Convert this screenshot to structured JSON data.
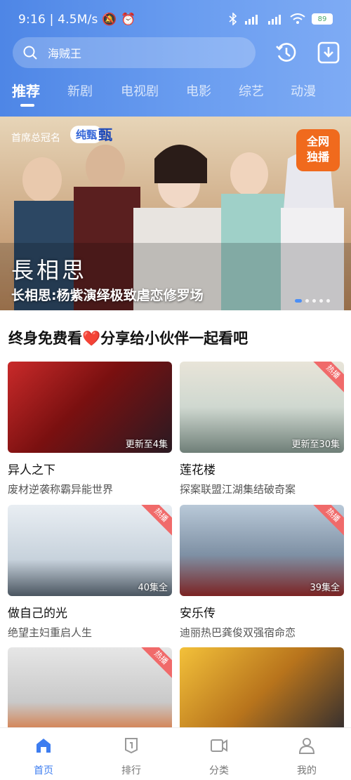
{
  "status": {
    "time": "9:16",
    "speed": "4.5M/s",
    "battery": "89"
  },
  "search": {
    "value": "海贼王"
  },
  "tabs": [
    {
      "label": "推荐",
      "active": true
    },
    {
      "label": "新剧"
    },
    {
      "label": "电视剧"
    },
    {
      "label": "电影"
    },
    {
      "label": "综艺"
    },
    {
      "label": "动漫"
    }
  ],
  "banner": {
    "sponsor": "首席总冠名",
    "sponsor_logo_1": "纯甄",
    "sponsor_logo_2": "甄",
    "badge_line1": "全网",
    "badge_line2": "独播",
    "drama_title": "長相思",
    "caption": "长相思:杨紫演绎极致虐恋修罗场"
  },
  "section": {
    "title": "终身免费看❤️分享给小伙伴一起看吧"
  },
  "cards": [
    {
      "title": "异人之下",
      "desc": "废材逆袭称霸异能世界",
      "episodes": "更新至4集",
      "corner": ""
    },
    {
      "title": "莲花楼",
      "desc": "探案联盟江湖集结破奇案",
      "episodes": "更新至30集",
      "corner": "热播"
    },
    {
      "title": "做自己的光",
      "desc": "绝望主妇重启人生",
      "episodes": "40集全",
      "corner": "热播"
    },
    {
      "title": "安乐传",
      "desc": "迪丽热巴龚俊双强宿命恋",
      "episodes": "39集全",
      "corner": "热播"
    },
    {
      "title": "",
      "desc": "",
      "episodes": "",
      "corner": "热播"
    },
    {
      "title": "",
      "desc": "",
      "episodes": "",
      "corner": ""
    }
  ],
  "bottom_nav": [
    {
      "label": "首页",
      "icon": "home-icon",
      "active": true
    },
    {
      "label": "排行",
      "icon": "rank-icon"
    },
    {
      "label": "分类",
      "icon": "category-icon"
    },
    {
      "label": "我的",
      "icon": "profile-icon"
    }
  ],
  "colors": {
    "accent": "#3d7df0",
    "header_start": "#4e86e6",
    "header_end": "#7eabf4",
    "hot_tag": "#f06a6a"
  }
}
